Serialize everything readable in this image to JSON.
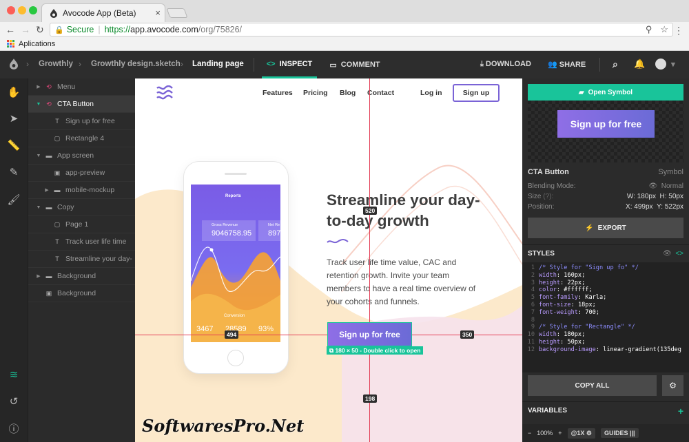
{
  "browser": {
    "tab_title": "Avocode App (Beta)",
    "url_secure_label": "Secure",
    "url_scheme": "https://",
    "url_host": "app.avocode.com",
    "url_path": "/org/75826/",
    "bookmarks_label": "Aplications"
  },
  "app": {
    "breadcrumbs": [
      "Growthly",
      "Growthly design.sketch",
      "Landing page"
    ],
    "tab_inspect": "INSPECT",
    "tab_comment": "COMMENT",
    "download": "DOWNLOAD",
    "share": "SHARE"
  },
  "layers": [
    {
      "label": "Menu",
      "kind": "symbol",
      "indent": 1,
      "expander": "right"
    },
    {
      "label": "CTA Button",
      "kind": "symbol",
      "indent": 1,
      "expander": "down",
      "selected": true
    },
    {
      "label": "Sign up for free",
      "kind": "text",
      "indent": 2
    },
    {
      "label": "Rectangle 4",
      "kind": "rect",
      "indent": 2
    },
    {
      "label": "App screen",
      "kind": "folder",
      "indent": 1,
      "expander": "down"
    },
    {
      "label": "app-preview",
      "kind": "image",
      "indent": 2
    },
    {
      "label": "mobile-mockup",
      "kind": "folder",
      "indent": 2,
      "expander": "right"
    },
    {
      "label": "Copy",
      "kind": "folder",
      "indent": 1,
      "expander": "down"
    },
    {
      "label": "Page 1",
      "kind": "rect",
      "indent": 2
    },
    {
      "label": "Track user life time",
      "kind": "text",
      "indent": 2
    },
    {
      "label": "Streamline your day-",
      "kind": "text",
      "indent": 2
    },
    {
      "label": "Background",
      "kind": "folder",
      "indent": 1,
      "expander": "right"
    },
    {
      "label": "Background",
      "kind": "image",
      "indent": 1
    }
  ],
  "landing": {
    "nav": [
      "Features",
      "Pricing",
      "Blog",
      "Contact"
    ],
    "login": "Log in",
    "signup": "Sign up",
    "hero_title": "Streamline your day-to-day growth",
    "hero_body": "Track user life time value, CAC and retention growth. Invite your team members to have a real time overview of your cohorts and funnels.",
    "cta": "Sign up for free",
    "cta_info": "180 × 50 - Double click to open",
    "measure_top": "520",
    "measure_left": "494",
    "measure_right": "350",
    "measure_bottom": "198",
    "phone": {
      "title": "Reports",
      "gross_label": "Gross Revenue",
      "gross_value": "9046758.95",
      "net_label": "Net Re",
      "net_value": "897",
      "conversion": "Conversion",
      "stats": [
        "3467",
        "28589",
        "93%"
      ]
    }
  },
  "watermark": "SoftwaresPro.Net",
  "inspector": {
    "open_symbol": "Open Symbol",
    "preview_text": "Sign up for free",
    "name": "CTA Button",
    "type": "Symbol",
    "blending_label": "Blending Mode:",
    "blending_value": "Normal",
    "size_label": "Size",
    "size_help": "(?):",
    "size_w": "W: 180px",
    "size_h": "H: 50px",
    "position_label": "Position:",
    "pos_x": "X: 499px",
    "pos_y": "Y: 522px",
    "export": "EXPORT",
    "styles": "STYLES",
    "code": [
      {
        "n": "1",
        "t": "comment",
        "text": "/* Style for \"Sign up fo\" */"
      },
      {
        "n": "2",
        "t": "decl",
        "prop": "width",
        "val": "160px"
      },
      {
        "n": "3",
        "t": "decl",
        "prop": "height",
        "val": "22px"
      },
      {
        "n": "4",
        "t": "decl",
        "prop": "color",
        "val": "#ffffff"
      },
      {
        "n": "5",
        "t": "decl",
        "prop": "font-family",
        "val": "Karla"
      },
      {
        "n": "6",
        "t": "decl",
        "prop": "font-size",
        "val": "18px"
      },
      {
        "n": "7",
        "t": "decl",
        "prop": "font-weight",
        "val": "700"
      },
      {
        "n": "8",
        "t": "blank"
      },
      {
        "n": "9",
        "t": "comment",
        "text": "/* Style for \"Rectangle\" */"
      },
      {
        "n": "10",
        "t": "decl",
        "prop": "width",
        "val": "180px"
      },
      {
        "n": "11",
        "t": "decl",
        "prop": "height",
        "val": "50px"
      },
      {
        "n": "12",
        "t": "decl",
        "prop": "background-image",
        "val": "linear-gradient(135deg"
      }
    ],
    "copy_all": "COPY ALL",
    "variables": "VARIABLES",
    "zoom": "100%",
    "scale": "@1X",
    "guides": "GUIDES"
  },
  "colors": {
    "accent": "#19c49a",
    "brand_purple": "#7a63d6",
    "guide_red": "#e33d55",
    "app_dark": "#2b2b2b"
  }
}
